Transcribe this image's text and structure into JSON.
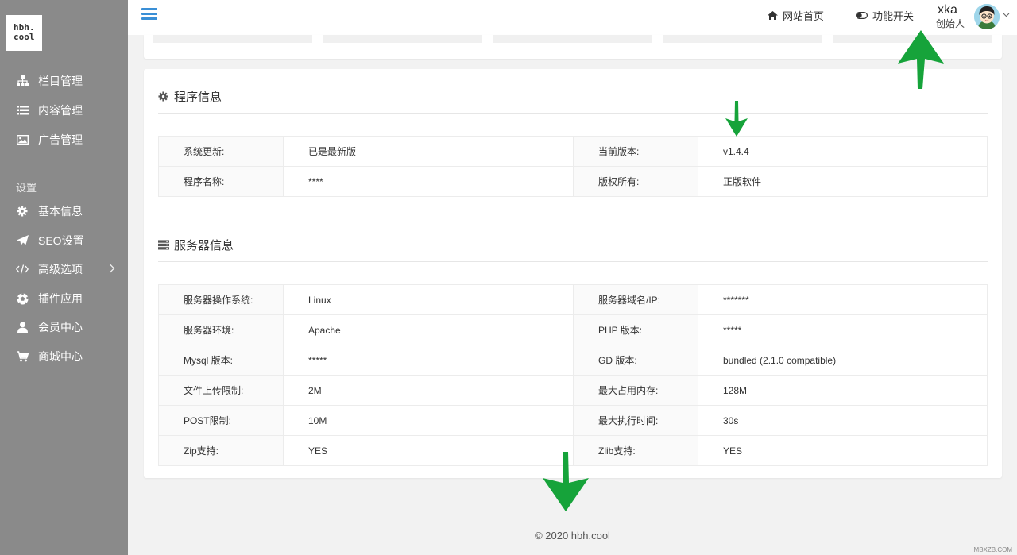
{
  "sidebar": {
    "logo_line1": "hbh.",
    "logo_line2": "cool",
    "items": [
      {
        "label": "栏目管理",
        "icon": "sitemap-icon"
      },
      {
        "label": "内容管理",
        "icon": "list-icon"
      },
      {
        "label": "广告管理",
        "icon": "image-icon"
      }
    ],
    "section_label": "设置",
    "settings_items": [
      {
        "label": "基本信息",
        "icon": "gear-icon"
      },
      {
        "label": "SEO设置",
        "icon": "paper-plane-icon"
      },
      {
        "label": "高级选项",
        "icon": "code-icon"
      },
      {
        "label": "插件应用",
        "icon": "soccer-ball-icon"
      },
      {
        "label": "会员中心",
        "icon": "user-icon"
      },
      {
        "label": "商城中心",
        "icon": "cart-icon"
      }
    ]
  },
  "header": {
    "home_link": "网站首页",
    "toggle_link": "功能开关",
    "user_name": "xka",
    "user_role": "创始人"
  },
  "program_info": {
    "title": "程序信息",
    "rows": [
      [
        "系统更新:",
        "已是最新版",
        "当前版本:",
        "v1.4.4"
      ],
      [
        "程序名称:",
        "****",
        "版权所有:",
        "正版软件"
      ]
    ]
  },
  "server_info": {
    "title": "服务器信息",
    "rows": [
      [
        "服务器操作系统:",
        "Linux",
        "服务器域名/IP:",
        "*******"
      ],
      [
        "服务器环境:",
        "Apache",
        "PHP 版本:",
        "*****"
      ],
      [
        "Mysql 版本:",
        "*****",
        "GD 版本:",
        "bundled (2.1.0 compatible)"
      ],
      [
        "文件上传限制:",
        "2M",
        "最大占用内存:",
        "128M"
      ],
      [
        "POST限制:",
        "10M",
        "最大执行时间:",
        "30s"
      ],
      [
        "Zip支持:",
        "YES",
        "Zlib支持:",
        "YES"
      ]
    ]
  },
  "footer": "© 2020 hbh.cool",
  "watermark": "MBXZB.COM",
  "colors": {
    "sidebar_bg": "#8a8a8a",
    "accent": "#3a8fd6",
    "arrow": "#16a33a"
  }
}
